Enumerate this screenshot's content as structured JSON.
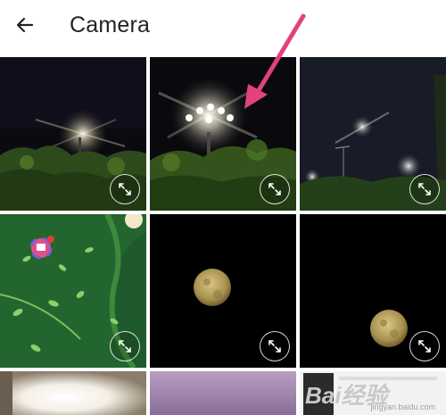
{
  "header": {
    "title": "Camera",
    "back_icon": "arrow-left-icon"
  },
  "photos": [
    {
      "subject": "night-street-lamp"
    },
    {
      "subject": "night-street-lamp-closeup"
    },
    {
      "subject": "night-sky-lamp"
    },
    {
      "subject": "green-illustrated-wallpaper"
    },
    {
      "subject": "moon"
    },
    {
      "subject": "moon"
    },
    {
      "subject": "bright-light"
    },
    {
      "subject": "purple-sky"
    },
    {
      "subject": "document"
    }
  ],
  "annotation": {
    "color": "#e3417c"
  },
  "watermark": {
    "brand": "Bai经验",
    "domain": "jingyan.baidu.com",
    "cn": "经验"
  },
  "colors": {
    "accent": "#e3417c",
    "title": "#222222",
    "background": "#ffffff"
  }
}
